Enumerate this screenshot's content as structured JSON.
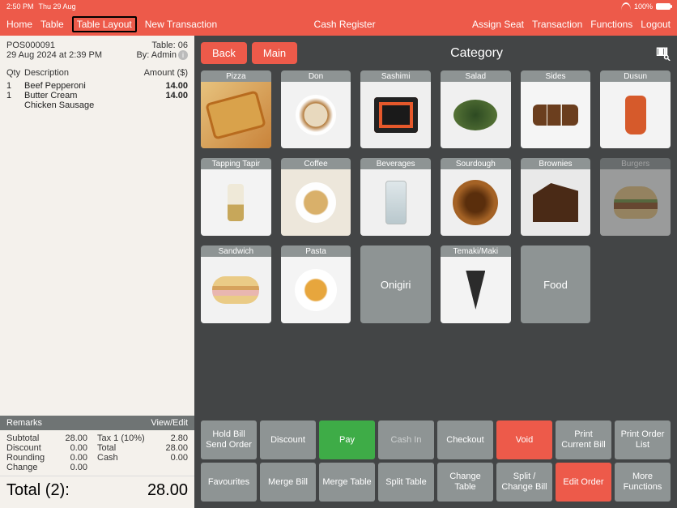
{
  "status": {
    "time": "2:50 PM",
    "date": "Thu 29 Aug",
    "battery": "100%"
  },
  "nav": {
    "left": [
      "Home",
      "Table",
      "Table Layout",
      "New Transaction"
    ],
    "title": "Cash Register",
    "right": [
      "Assign Seat",
      "Transaction",
      "Functions",
      "Logout"
    ]
  },
  "receipt": {
    "pos_id": "POS000091",
    "table": "Table: 06",
    "timestamp": "29 Aug 2024 at 2:39 PM",
    "by": "By: Admin",
    "cols": {
      "qty": "Qty",
      "desc": "Description",
      "amt": "Amount ($)"
    },
    "items": [
      {
        "qty": "1",
        "name": "Beef Pepperoni",
        "amount": "14.00"
      },
      {
        "qty": "1",
        "name": "Butter Cream",
        "amount": "14.00",
        "sub": "Chicken Sausage"
      }
    ],
    "remarks": {
      "label": "Remarks",
      "action": "View/Edit"
    },
    "lines": {
      "subtotal_l": "Subtotal",
      "subtotal_v": "28.00",
      "tax_l": "Tax 1 (10%)",
      "tax_v": "2.80",
      "discount_l": "Discount",
      "discount_v": "0.00",
      "total_l": "Total",
      "total_v": "28.00",
      "rounding_l": "Rounding",
      "rounding_v": "0.00",
      "cash_l": "Cash",
      "cash_v": "0.00",
      "change_l": "Change",
      "change_v": "0.00"
    },
    "grand": {
      "label": "Total (2):",
      "value": "28.00"
    }
  },
  "panel": {
    "back": "Back",
    "main": "Main",
    "title": "Category",
    "categories": [
      {
        "name": "Pizza",
        "img": "pizza"
      },
      {
        "name": "Don",
        "img": "don"
      },
      {
        "name": "Sashimi",
        "img": "sashimi"
      },
      {
        "name": "Salad",
        "img": "salad"
      },
      {
        "name": "Sides",
        "img": "sides"
      },
      {
        "name": "Dusun",
        "img": "dusun"
      },
      {
        "name": "Tapping Tapir",
        "img": "tapir"
      },
      {
        "name": "Coffee",
        "img": "coffee"
      },
      {
        "name": "Beverages",
        "img": "bev"
      },
      {
        "name": "Sourdough",
        "img": "sour"
      },
      {
        "name": "Brownies",
        "img": "brown"
      },
      {
        "name": "Burgers",
        "img": "burger",
        "faded": true
      },
      {
        "name": "Sandwich",
        "img": "sand"
      },
      {
        "name": "Pasta",
        "img": "pasta"
      },
      {
        "name": "Onigiri",
        "noimg": true
      },
      {
        "name": "Temaki/Maki",
        "img": "temaki"
      },
      {
        "name": "Food",
        "noimg": true
      }
    ],
    "fn_row1": [
      {
        "label": "Hold Bill\nSend Order"
      },
      {
        "label": "Discount"
      },
      {
        "label": "Pay",
        "cls": "green"
      },
      {
        "label": "Cash In",
        "cls": "dim"
      },
      {
        "label": "Checkout"
      },
      {
        "label": "Void",
        "cls": "red"
      },
      {
        "label": "Print\nCurrent Bill"
      },
      {
        "label": "Print Order\nList"
      }
    ],
    "fn_row2": [
      {
        "label": "Favourites"
      },
      {
        "label": "Merge Bill"
      },
      {
        "label": "Merge Table"
      },
      {
        "label": "Split Table"
      },
      {
        "label": "Change\nTable"
      },
      {
        "label": "Split /\nChange Bill"
      },
      {
        "label": "Edit Order",
        "cls": "red"
      },
      {
        "label": "More\nFunctions"
      }
    ]
  }
}
